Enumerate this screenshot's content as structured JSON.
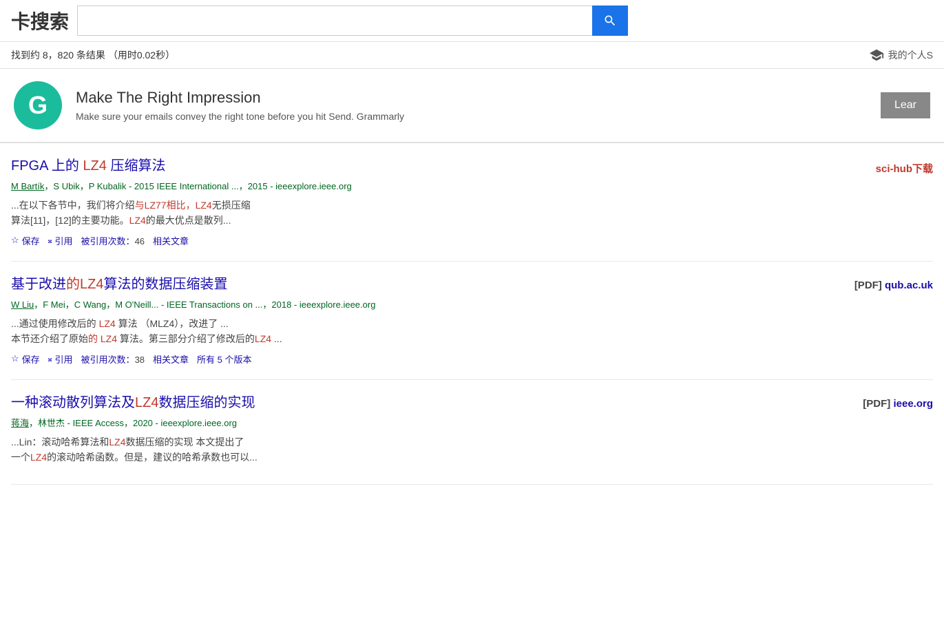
{
  "header": {
    "title": "卡搜索",
    "search_placeholder": "",
    "search_value": "",
    "search_button_label": "搜索"
  },
  "results_bar": {
    "text": "找到约 8，820 条结果",
    "time_label": "（用时",
    "time_value": "0.02",
    "time_suffix": "秒）",
    "personal_label": "我的个人S"
  },
  "ad": {
    "logo_letter": "G",
    "title": "Make The Right Impression",
    "subtitle": "Make sure your emails convey the right tone before you hit Send. Grammarly",
    "cta_label": "Lear"
  },
  "results": [
    {
      "title_parts": [
        {
          "text": "FPGA 上的 ",
          "highlight": false
        },
        {
          "text": "LZ4",
          "highlight": true
        },
        {
          "text": " 压缩算法",
          "highlight": false
        }
      ],
      "meta": "M Bartík，S Ubik，P Kubalik - 2015 IEEE International ...，2015 - ieeexplore.ieee.org",
      "meta_underline": "M Bartík",
      "snippet_parts": [
        {
          "text": "...在以下各节中，我们将介绍",
          "highlight": false
        },
        {
          "text": "与LZ77相比，LZ4",
          "highlight": true
        },
        {
          "text": "无损压缩\n算法[11]，[12]的主要功能。",
          "highlight": false
        },
        {
          "text": "LZ4",
          "highlight": true
        },
        {
          "text": "的最大优点是散列...",
          "highlight": false
        }
      ],
      "actions": [
        {
          "icon": "star",
          "label": "保存"
        },
        {
          "icon": "cite",
          "label": "引用"
        },
        {
          "label": "被引用次数：",
          "count": "46",
          "type": "count"
        },
        {
          "label": "相关文章",
          "type": "link"
        }
      ],
      "side": {
        "type": "scihub",
        "label": "sci-hub下载"
      }
    },
    {
      "title_parts": [
        {
          "text": "基于改进",
          "highlight": false
        },
        {
          "text": "的LZ4",
          "highlight": true
        },
        {
          "text": "算法的数据压缩装置",
          "highlight": false
        }
      ],
      "meta": "W Liu，F Mei，C Wang，M O'Neill... - IEEE Transactions on ...，2018 - ieeexplore.ieee.org",
      "meta_underline": "W Liu",
      "snippet_parts": [
        {
          "text": "...通过使用修改后的 ",
          "highlight": false
        },
        {
          "text": "LZ4",
          "highlight": true
        },
        {
          "text": " 算法 （MLZ4），改进了 ...\n本节还介绍了原始",
          "highlight": false
        },
        {
          "text": "的 LZ4",
          "highlight": true
        },
        {
          "text": " 算法。第三部分介绍了修改后的",
          "highlight": false
        },
        {
          "text": "LZ4",
          "highlight": true
        },
        {
          "text": " ...",
          "highlight": false
        }
      ],
      "actions": [
        {
          "icon": "star",
          "label": "保存"
        },
        {
          "icon": "cite",
          "label": "引用"
        },
        {
          "label": "被引用次数：",
          "count": "38",
          "type": "count"
        },
        {
          "label": "相关文章",
          "type": "link"
        },
        {
          "label": "所有 5 个版本",
          "type": "link"
        }
      ],
      "side": {
        "type": "pdf",
        "pdf_label": "[PDF]",
        "domain": "qub.ac.uk"
      }
    },
    {
      "title_parts": [
        {
          "text": "一种滚动散列算法及",
          "highlight": false
        },
        {
          "text": "LZ4",
          "highlight": true
        },
        {
          "text": "数据压缩的实现",
          "highlight": false
        }
      ],
      "meta": "蒋海，林世杰 - IEEE Access，2020 - ieeexplore.ieee.org",
      "meta_underline": "蒋海",
      "snippet_parts": [
        {
          "text": "...Lin：滚动哈希算法和",
          "highlight": false
        },
        {
          "text": "LZ4",
          "highlight": true
        },
        {
          "text": "数据压缩的实现 本文提出了\n一个",
          "highlight": false
        },
        {
          "text": "LZ4",
          "highlight": true
        },
        {
          "text": "的滚动哈希函数。但是，建议的哈希承数也可以...",
          "highlight": false
        }
      ],
      "actions": [],
      "side": {
        "type": "pdf",
        "pdf_label": "[PDF]",
        "domain": "ieee.org"
      }
    }
  ]
}
